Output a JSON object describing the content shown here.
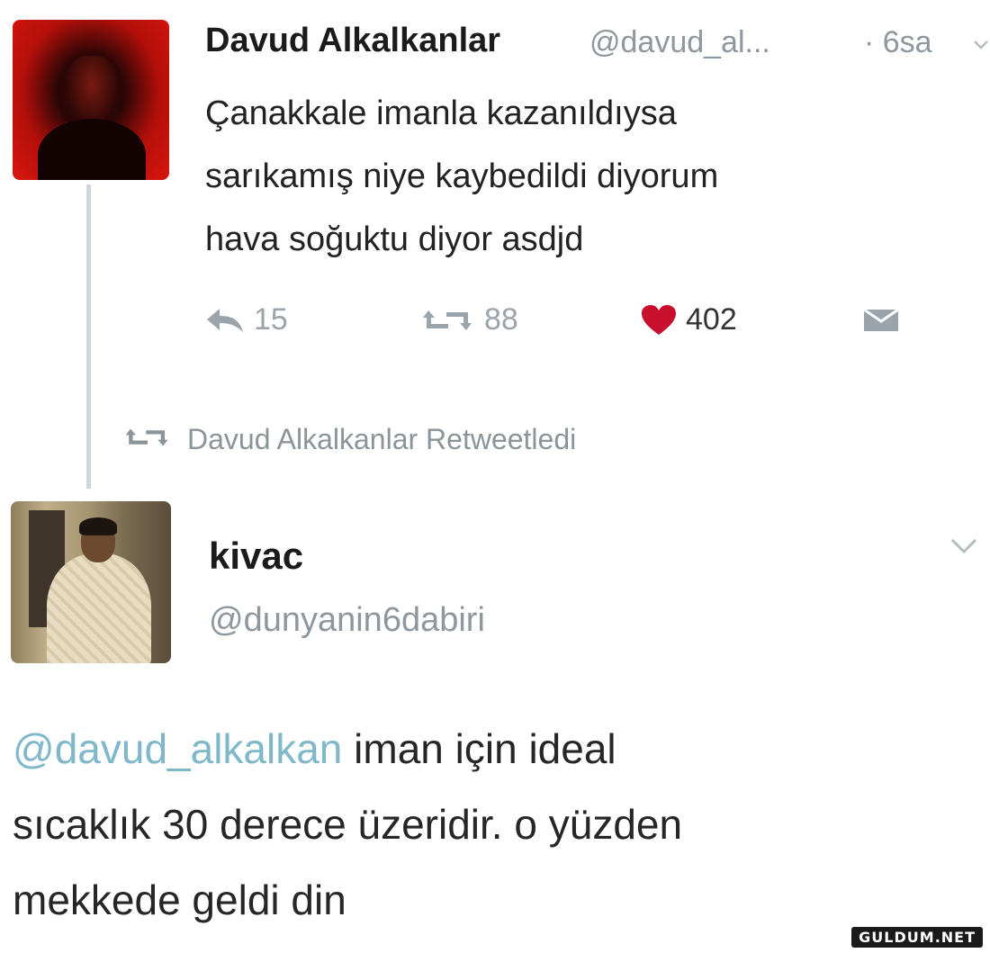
{
  "tweet1": {
    "author_name": "Davud Alkalkanlar",
    "author_handle": "@davud_al...",
    "time": "· 6sa",
    "text_lines": [
      "Çanakkale imanla kazanıldıysa",
      "sarıkamış niye kaybedildi diyorum",
      "hava soğuktu diyor asdjd"
    ],
    "reply_count": "15",
    "retweet_count": "88",
    "like_count": "402"
  },
  "retweet_bar": {
    "label": "Davud Alkalkanlar Retweetledi"
  },
  "tweet2": {
    "author_name": "kivac",
    "author_handle": "@dunyanin6dabiri",
    "mention": "@davud_alkalkan",
    "text_line1_rest": " iman için ideal",
    "text_line2": "sıcaklık 30 derece üzeridir. o yüzden",
    "text_line3": "mekkede geldi din"
  },
  "watermark": "GULDUM.NET",
  "colors": {
    "like_heart": "#c8102e",
    "mention": "#7fb8c9",
    "icon_gray": "#9aa4aa"
  },
  "icons": [
    "reply-icon",
    "retweet-icon",
    "heart-icon",
    "dm-icon",
    "chevron-down-icon"
  ]
}
